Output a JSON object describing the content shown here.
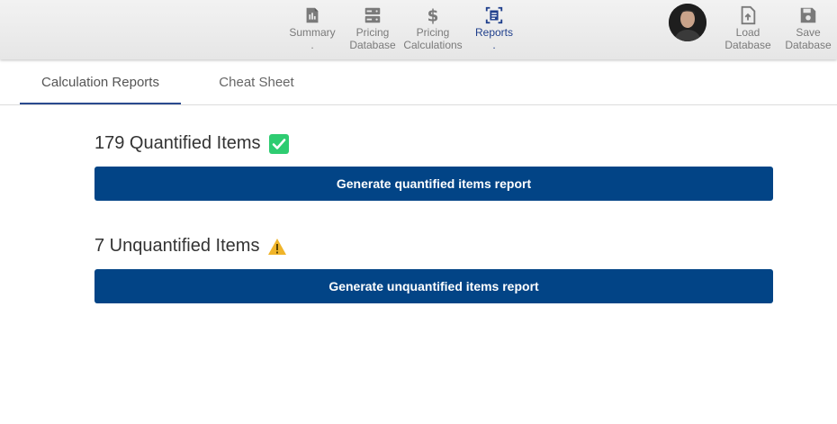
{
  "nav": {
    "items": [
      {
        "label": "Summary\n.",
        "icon": "summary-icon"
      },
      {
        "label": "Pricing\nDatabase",
        "icon": "database-icon"
      },
      {
        "label": "Pricing\nCalculations",
        "icon": "dollar-icon"
      },
      {
        "label": "Reports\n.",
        "icon": "reports-icon",
        "active": true
      }
    ],
    "actions": [
      {
        "label": "Load\nDatabase",
        "icon": "upload-file-icon"
      },
      {
        "label": "Save\nDatabase",
        "icon": "save-icon"
      }
    ]
  },
  "tabs": [
    {
      "label": "Calculation Reports",
      "active": true
    },
    {
      "label": "Cheat Sheet",
      "active": false
    }
  ],
  "sections": {
    "quantified": {
      "title": "179 Quantified Items",
      "status_icon": "check-icon",
      "status_color": "#2ecc71",
      "button_label": "Generate quantified items report"
    },
    "unquantified": {
      "title": "7 Unquantified Items",
      "status_icon": "warning-icon",
      "status_color": "#f0b429",
      "button_label": "Generate unquantified items report"
    }
  },
  "colors": {
    "accent": "#024486",
    "nav_active": "#1f3f8c",
    "nav_inactive": "#7a7a7a"
  }
}
